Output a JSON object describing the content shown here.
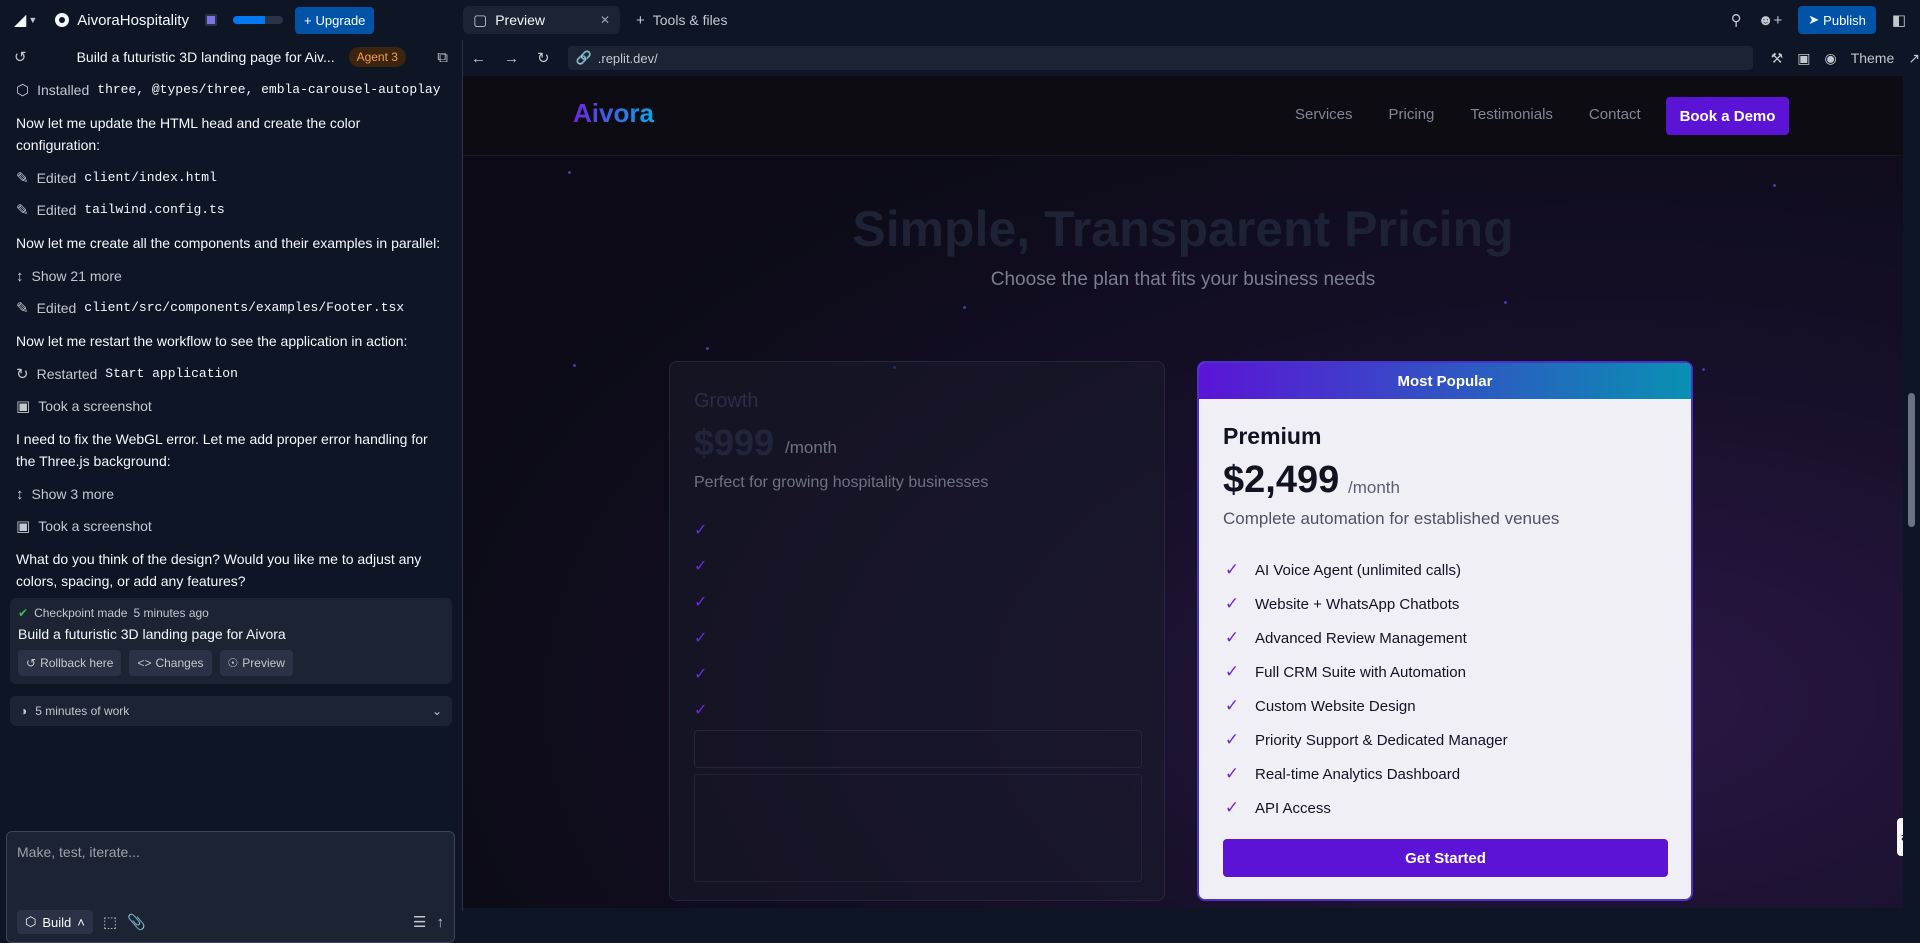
{
  "topbar": {
    "project_name": "AivoraHospitality",
    "upgrade_label": "Upgrade",
    "publish_label": "Publish",
    "progress_fraction": 0.65,
    "tabs": [
      {
        "label": "Preview",
        "active": true
      },
      {
        "label": "Tools & files",
        "active": false
      }
    ]
  },
  "chat": {
    "title": "Build a futuristic 3D landing page for Aiv...",
    "agent_badge": "Agent 3",
    "feed": [
      {
        "kind": "action",
        "icon": "package-icon",
        "text": "Installed ",
        "code": "three, @types/three, embla-carousel-autoplay"
      },
      {
        "kind": "message",
        "text": "Now let me update the HTML head and create the color configuration:"
      },
      {
        "kind": "action",
        "icon": "edit-icon",
        "text": "Edited ",
        "code": "client/index.html"
      },
      {
        "kind": "action",
        "icon": "edit-icon",
        "text": "Edited ",
        "code": "tailwind.config.ts"
      },
      {
        "kind": "message",
        "text": "Now let me create all the components and their examples in parallel:"
      },
      {
        "kind": "action",
        "icon": "expand-icon",
        "text": "Show 21 more",
        "code": ""
      },
      {
        "kind": "action",
        "icon": "edit-icon",
        "text": "Edited ",
        "code": "client/src/components/examples/Footer.tsx"
      },
      {
        "kind": "message",
        "text": "Now let me restart the workflow to see the application in action:"
      },
      {
        "kind": "action",
        "icon": "restart-icon",
        "text": "Restarted ",
        "code": "Start application"
      },
      {
        "kind": "action",
        "icon": "camera-icon",
        "text": "Took a screenshot",
        "code": ""
      },
      {
        "kind": "message",
        "text": "I need to fix the WebGL error. Let me add proper error handling for the Three.js background:"
      },
      {
        "kind": "action",
        "icon": "expand-icon",
        "text": "Show 3 more",
        "code": ""
      },
      {
        "kind": "action",
        "icon": "camera-icon",
        "text": "Took a screenshot",
        "code": ""
      },
      {
        "kind": "message",
        "text": "What do you think of the design? Would you like me to adjust any colors, spacing, or add any features?"
      }
    ],
    "checkpoint": {
      "head": "Checkpoint made",
      "time": "5 minutes ago",
      "title": "Build a futuristic 3D landing page for Aivora",
      "rollback_label": "Rollback here",
      "changes_label": "Changes",
      "preview_label": "Preview"
    },
    "work_summary": "5 minutes of work",
    "composer_placeholder": "Make, test, iterate...",
    "build_label": "Build"
  },
  "browser": {
    "url": ".replit.dev/",
    "theme_label": "Theme"
  },
  "site": {
    "brand": "Aivora",
    "nav": [
      "Services",
      "Pricing",
      "Testimonials",
      "Contact"
    ],
    "cta": "Book a Demo",
    "title": "Simple, Transparent Pricing",
    "subtitle": "Choose the plan that fits your business needs",
    "growth": {
      "name": "Growth",
      "price": "$999",
      "per": "/month",
      "desc": "Perfect for growing hospitality businesses",
      "check_count": 6
    },
    "premium": {
      "badge": "Most Popular",
      "name": "Premium",
      "price": "$2,499",
      "per": "/month",
      "desc": "Complete automation for established venues",
      "features": [
        "AI Voice Agent (unlimited calls)",
        "Website + WhatsApp Chatbots",
        "Advanced Review Management",
        "Full CRM Suite with Automation",
        "Custom Website Design",
        "Priority Support & Dedicated Manager",
        "Real-time Analytics Dashboard",
        "API Access"
      ],
      "button": "Get Started"
    }
  },
  "colors": {
    "accent": "#5b14d6",
    "replit_blue": "#0053a6",
    "agent_orange": "#f99d4a"
  }
}
